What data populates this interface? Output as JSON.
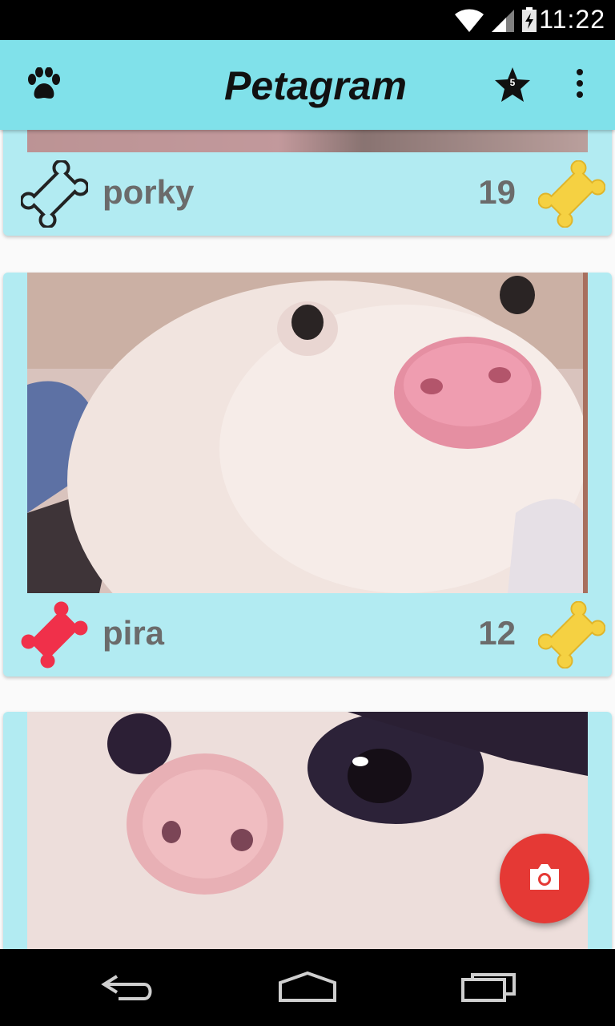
{
  "status_bar": {
    "time": "11:22"
  },
  "toolbar": {
    "title": "Petagram",
    "favorites_badge": "5"
  },
  "posts": [
    {
      "name": "porky",
      "likes": "19",
      "liked": false
    },
    {
      "name": "pira",
      "likes": "12",
      "liked": true
    }
  ],
  "colors": {
    "toolbar": "#80e1ea",
    "card": "#b2ebf2",
    "liked_bone": "#f0304a",
    "rating_bone": "#f5d142",
    "fab": "#e53935"
  },
  "icons": {
    "toolbar": [
      "paw-icon",
      "star-icon",
      "more-vert-icon"
    ],
    "post": [
      "bone-outline-icon",
      "bone-filled-icon",
      "bone-rating-icon"
    ],
    "fab": "camera-icon",
    "nav": [
      "back-icon",
      "home-icon",
      "recents-icon"
    ]
  }
}
